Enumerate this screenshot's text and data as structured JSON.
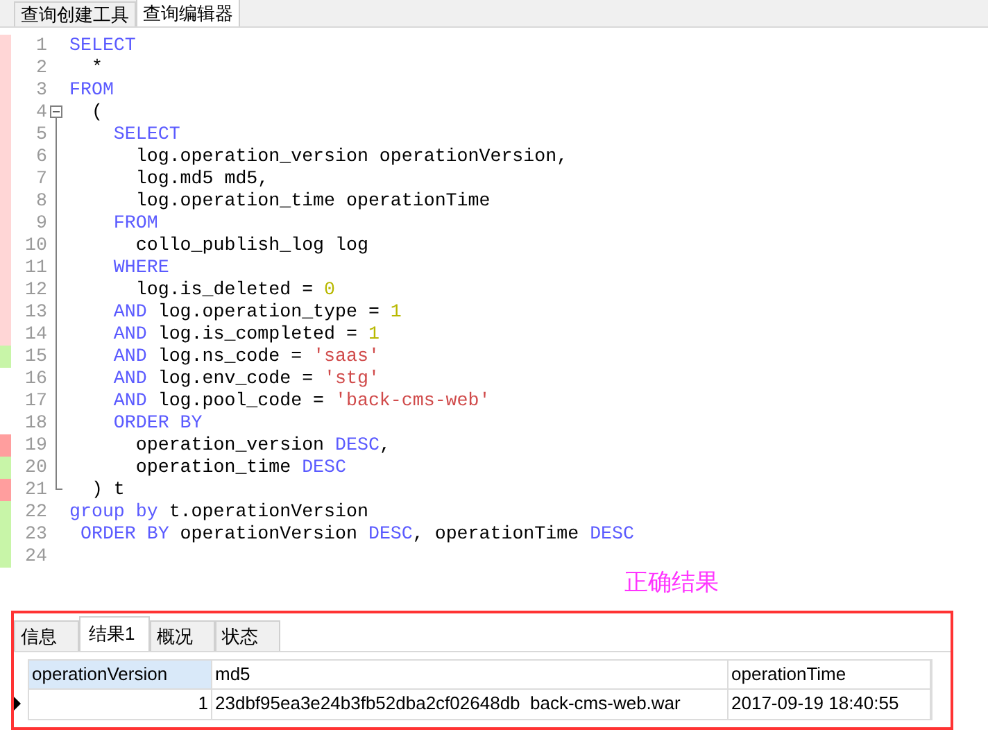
{
  "top_tabs": [
    {
      "label": "查询创建工具",
      "selected": false
    },
    {
      "label": "查询编辑器",
      "selected": true
    }
  ],
  "editor": {
    "lines": [
      {
        "number": "1",
        "color": "#ffd6d6",
        "tokens": [
          {
            "kind": "kw",
            "text": "SELECT"
          }
        ]
      },
      {
        "number": "2",
        "color": "#ffd6d6",
        "tokens": [
          {
            "kind": "plain",
            "text": "  *"
          }
        ]
      },
      {
        "number": "3",
        "color": "#ffd6d6",
        "tokens": [
          {
            "kind": "kw",
            "text": "FROM"
          }
        ]
      },
      {
        "number": "4",
        "color": "#ffd6d6",
        "fold_start": true,
        "tokens": [
          {
            "kind": "plain",
            "text": "  ("
          }
        ]
      },
      {
        "number": "5",
        "color": "#ffd6d6",
        "tokens": [
          {
            "kind": "kw",
            "text": "    SELECT"
          }
        ]
      },
      {
        "number": "6",
        "color": "#ffd6d6",
        "tokens": [
          {
            "kind": "plain",
            "text": "      log.operation_version operationVersion,"
          }
        ]
      },
      {
        "number": "7",
        "color": "#ffd6d6",
        "tokens": [
          {
            "kind": "plain",
            "text": "      log.md5 md5,"
          }
        ]
      },
      {
        "number": "8",
        "color": "#ffd6d6",
        "tokens": [
          {
            "kind": "plain",
            "text": "      log.operation_time operationTime"
          }
        ]
      },
      {
        "number": "9",
        "color": "#ffd6d6",
        "tokens": [
          {
            "kind": "kw",
            "text": "    FROM"
          }
        ]
      },
      {
        "number": "10",
        "color": "#ffd6d6",
        "tokens": [
          {
            "kind": "plain",
            "text": "      collo_publish_log log"
          }
        ]
      },
      {
        "number": "11",
        "color": "#ffd6d6",
        "tokens": [
          {
            "kind": "kw",
            "text": "    WHERE"
          }
        ]
      },
      {
        "number": "12",
        "color": "#ffd6d6",
        "tokens": [
          {
            "kind": "plain",
            "text": "      log.is_deleted = "
          },
          {
            "kind": "num",
            "text": "0"
          }
        ]
      },
      {
        "number": "13",
        "color": "#ffd6d6",
        "tokens": [
          {
            "kind": "kw",
            "text": "    AND"
          },
          {
            "kind": "plain",
            "text": " log.operation_type = "
          },
          {
            "kind": "num",
            "text": "1"
          }
        ]
      },
      {
        "number": "14",
        "color": "#ffd6d6",
        "tokens": [
          {
            "kind": "kw",
            "text": "    AND"
          },
          {
            "kind": "plain",
            "text": " log.is_completed = "
          },
          {
            "kind": "num",
            "text": "1"
          }
        ]
      },
      {
        "number": "15",
        "color": "#c8f5a8",
        "tokens": [
          {
            "kind": "kw",
            "text": "    AND"
          },
          {
            "kind": "plain",
            "text": " log.ns_code = "
          },
          {
            "kind": "str",
            "text": "'saas'"
          }
        ]
      },
      {
        "number": "16",
        "tokens": [
          {
            "kind": "kw",
            "text": "    AND"
          },
          {
            "kind": "plain",
            "text": " log.env_code = "
          },
          {
            "kind": "str",
            "text": "'stg'"
          }
        ]
      },
      {
        "number": "17",
        "tokens": [
          {
            "kind": "kw",
            "text": "    AND"
          },
          {
            "kind": "plain",
            "text": " log.pool_code = "
          },
          {
            "kind": "str",
            "text": "'back-cms-web'"
          }
        ]
      },
      {
        "number": "18",
        "tokens": [
          {
            "kind": "kw",
            "text": "    ORDER BY"
          }
        ]
      },
      {
        "number": "19",
        "color": "#ff9e9e",
        "tokens": [
          {
            "kind": "plain",
            "text": "      operation_version "
          },
          {
            "kind": "kw",
            "text": "DESC"
          },
          {
            "kind": "plain",
            "text": ","
          }
        ]
      },
      {
        "number": "20",
        "color": "#c8f5a8",
        "tokens": [
          {
            "kind": "plain",
            "text": "      operation_time "
          },
          {
            "kind": "kw",
            "text": "DESC"
          }
        ]
      },
      {
        "number": "21",
        "color": "#ff9e9e",
        "fold_end": true,
        "tokens": [
          {
            "kind": "plain",
            "text": "  ) t"
          }
        ]
      },
      {
        "number": "22",
        "color": "#c8f5a8",
        "tokens": [
          {
            "kind": "kw",
            "text": "group by"
          },
          {
            "kind": "plain",
            "text": " t.operationVersion"
          }
        ]
      },
      {
        "number": "23",
        "color": "#c8f5a8",
        "tokens": [
          {
            "kind": "kw",
            "text": " ORDER BY"
          },
          {
            "kind": "plain",
            "text": " operationVersion "
          },
          {
            "kind": "kw",
            "text": "DESC"
          },
          {
            "kind": "plain",
            "text": ", operationTime "
          },
          {
            "kind": "kw",
            "text": "DESC"
          }
        ]
      },
      {
        "number": "24",
        "color": "#c8f5a8"
      }
    ]
  },
  "annotation": "正确结果",
  "result_tabs": [
    {
      "label": "信息",
      "selected": false
    },
    {
      "label": "结果1",
      "selected": true
    },
    {
      "label": "概况",
      "selected": false
    },
    {
      "label": "状态",
      "selected": false
    }
  ],
  "table": {
    "columns": [
      "operationVersion",
      "md5",
      "operationTime"
    ],
    "rows": [
      {
        "current": true,
        "cells": [
          "1",
          "23dbf95ea3e24b3fb52dba2cf02648db  back-cms-web.war",
          "2017-09-19 18:40:55"
        ]
      }
    ]
  }
}
